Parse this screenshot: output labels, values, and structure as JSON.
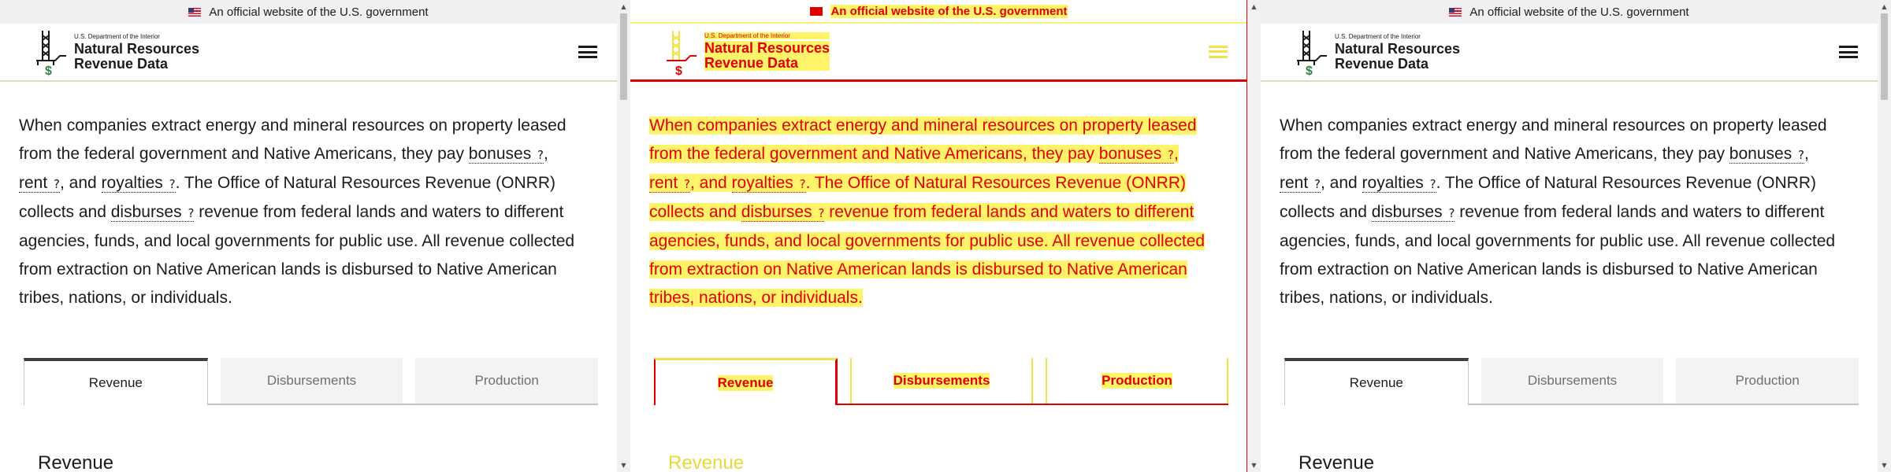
{
  "gov_banner": {
    "text": "An official website of the U.S. government"
  },
  "header": {
    "dept": "U.S. Department of the Interior",
    "title_line1": "Natural Resources",
    "title_line2": "Revenue Data",
    "menu_icon": "hamburger-menu-icon"
  },
  "intro": {
    "p1": "When companies extract energy and mineral resources on property leased from the federal government and Native Americans, they pay ",
    "term_bonuses": "bonuses",
    "sep1": ", ",
    "term_rent": "rent",
    "sep2": ", and ",
    "term_royalties": "royalties",
    "p2": ". The Office of Natural Resources Revenue (ONRR) collects and ",
    "term_disburses": "disburses",
    "p3": " revenue from federal lands and waters to different agencies, funds, and local governments for public use. All revenue collected from extraction on Native American lands is disbursed to Native American tribes, nations, or individuals.",
    "help_glyph": "?"
  },
  "tabs": [
    {
      "label": "Revenue",
      "active": true
    },
    {
      "label": "Disbursements",
      "active": false
    },
    {
      "label": "Production",
      "active": false
    }
  ],
  "section_title": "Revenue",
  "colors": {
    "accent_dark": "#3d3d3d",
    "banner_bg": "#f0f0f0",
    "header_rule": "#cfe3c4",
    "debug_red": "#e00000",
    "debug_yellow": "#fff36a"
  }
}
